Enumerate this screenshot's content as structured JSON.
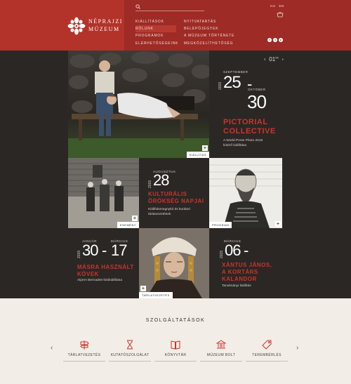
{
  "header": {
    "logo_line1": "NÉPRAJZI",
    "logo_line2": "MÚZEUM",
    "search_placeholder": "",
    "menu_left": [
      "KIÁLLÍTÁSOK",
      "RÓLUNK",
      "PROGRAMOK",
      "ELÉRHETŐSÉGEINK"
    ],
    "menu_right": [
      "NYITVATARTÁS",
      "BELÉPŐJEGYEK",
      "A MÚZEUM TÖRTÉNETE",
      "MEGKÖZELÍTHETŐSÉG"
    ],
    "lang_hu": "HU",
    "lang_en": "EN",
    "social": [
      "f",
      "t",
      "y"
    ]
  },
  "slider": {
    "prev": "‹",
    "current": "01",
    "total": "05",
    "next": "›"
  },
  "feature": {
    "tag": "KIÁLLÍTÁS",
    "month_start": "SZEPTEMBER",
    "year": "2015",
    "day_start": "25",
    "dash": "-",
    "month_end": "OKTÓBER",
    "day_end": "30",
    "title_line1": "PICTORIAL",
    "title_line2": "COLLECTIVE",
    "sub_line1": "A World Press Photo 2015",
    "sub_line2": "kísérő kiállítása"
  },
  "tile_event": {
    "tag": "ESEMÉNY"
  },
  "tile_heritage": {
    "month": "AUGUSZTUS",
    "year": "2015",
    "day": "28",
    "title_line1": "KULTURÁLIS",
    "title_line2": "ÖRÖKSÉG NAPJAI",
    "sub_line1": "Kiállításmegnyitó és kurátori",
    "sub_line2": "tárlatvezetések"
  },
  "tile_program": {
    "tag": "PROGRAM"
  },
  "tile_stones": {
    "month_start": "JANUÁR",
    "month_end": "MÁRCIUS",
    "year": "2015",
    "day_start": "30",
    "dash": "-",
    "day_end": "17",
    "title_line1": "MÁSRA HASZNÁLT",
    "title_line2": "KÖVEK",
    "sub": "Alpern Bernadett fotókiállítása"
  },
  "tile_guided": {
    "tag": "TÁRLATVEZETÉS"
  },
  "tile_xantus": {
    "month": "MÁRCIUS",
    "year": "2015",
    "day": "06",
    "dash": "-",
    "title_line1": "XÁNTUS JÁNOS,",
    "title_line2": "A KORTÁRS",
    "title_line3": "KALANDOR",
    "sub": "Tanulmányi kiállítás"
  },
  "services": {
    "title": "SZOLGÁLTATÁSOK",
    "prev": "‹",
    "next": "›",
    "items": [
      {
        "label": "TÁRLATVEZETÉS",
        "icon": "signpost-icon"
      },
      {
        "label": "KUTATÓSZOLGÁLAT",
        "icon": "hourglass-icon"
      },
      {
        "label": "KÖNYVTÁR",
        "icon": "book-icon"
      },
      {
        "label": "MÚZEUM BOLT",
        "icon": "museum-icon"
      },
      {
        "label": "TEREMBÉRLÉS",
        "icon": "tag-icon"
      }
    ]
  },
  "colors": {
    "brand_red": "#9e2b25",
    "accent_red": "#c9352c",
    "dark_bg": "#2b2725",
    "cream": "#f2ede6"
  }
}
